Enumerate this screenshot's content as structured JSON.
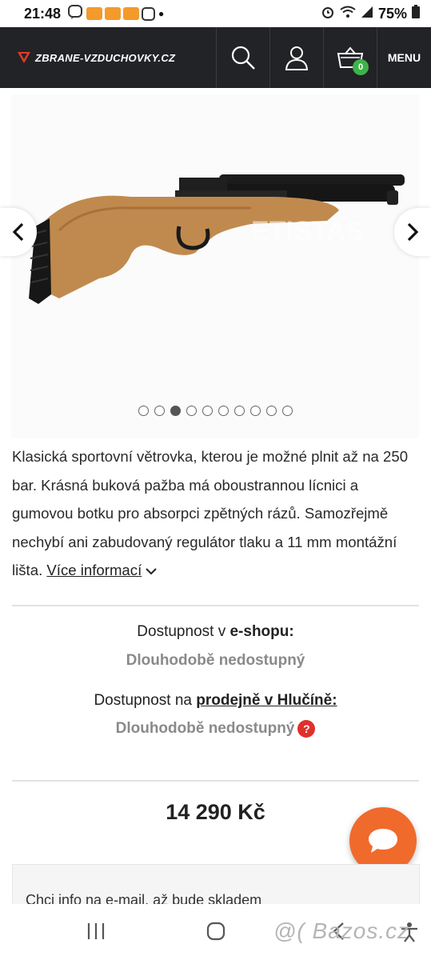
{
  "status_bar": {
    "time": "21:48",
    "battery": "75%"
  },
  "header": {
    "logo_text": "ZBRANE-VZDUCHOVKY.CZ",
    "cart_count": "0",
    "menu_label": "MENU",
    "colors": {
      "background": "#222326",
      "accent": "#e23b2a",
      "badge": "#3fb24a"
    },
    "icons": [
      "search-icon",
      "user-icon",
      "basket-icon"
    ]
  },
  "gallery": {
    "prev_icon": "chevron-left-icon",
    "next_icon": "chevron-right-icon",
    "dots_total": 10,
    "active_dot": 3
  },
  "description": {
    "text": "Klasická sportovní větrovka, kterou je možné plnit až na 250 bar. Krásná buková pažba má oboustrannou lícnici a gumovou botku pro absorpci zpětných rázů. Samozřejmě nechybí ani zabudovaný regulátor tlaku a 11 mm montážní lišta.",
    "more_link": "Více informací"
  },
  "availability": {
    "eshop_prefix": "Dostupnost v",
    "eshop_bold": "e-shopu:",
    "eshop_status": "Dlouhodobě nedostupný",
    "store_prefix": "Dostupnost na",
    "store_link": "prodejně v Hlučíně:",
    "store_status": "Dlouhodobě nedostupný",
    "help_icon": "?"
  },
  "price": "14 290 Kč",
  "notify": {
    "text": "Chci info na e-mail, až bude skladem"
  },
  "watermark": "@( Bazos.cz"
}
